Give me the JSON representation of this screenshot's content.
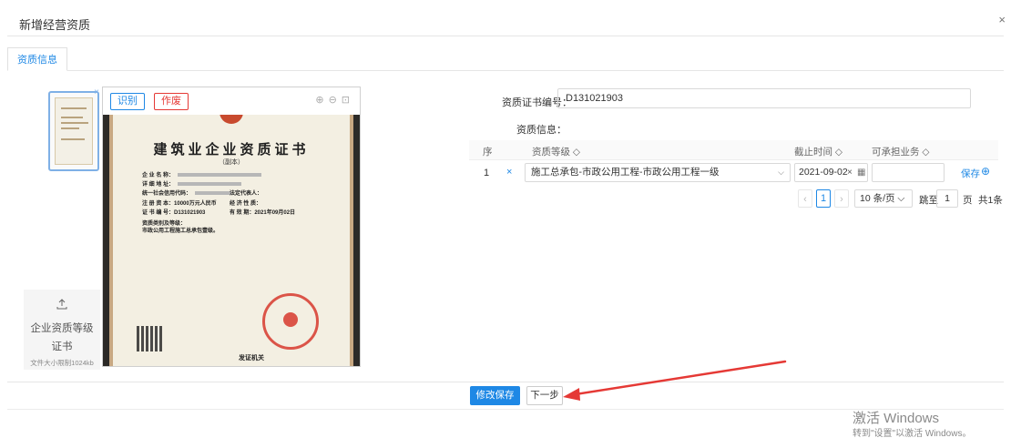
{
  "modal": {
    "title": "新增经营资质",
    "close": "×"
  },
  "tabs": [
    {
      "label": "资质信息"
    }
  ],
  "thumbnail": {
    "close": "×"
  },
  "upload": {
    "icon": "upload-icon",
    "label": "企业资质等级证书",
    "hint": "文件大小限制1024kb"
  },
  "viewer": {
    "recognize_label": "识别",
    "void_label": "作废",
    "tools": [
      "zoom-in-icon",
      "zoom-out-icon",
      "fit-icon"
    ]
  },
  "certificate": {
    "title": "建筑业企业资质证书",
    "subtitle": "（副本）",
    "fields": [
      {
        "label": "企 业 名 称："
      },
      {
        "label": "详 细 地 址："
      },
      {
        "label": "统一社会信用代码："
      },
      {
        "label": "注 册 资 本：",
        "value": "10000万元人民币"
      },
      {
        "label": "证 书 编 号：",
        "value": "D131021903"
      }
    ],
    "fields_right": [
      {
        "label": "法定代表人："
      },
      {
        "label": "经 济 性 质："
      },
      {
        "label": "有 效 期：",
        "value": "2021年09月02日"
      }
    ],
    "scope_title": "资质类别及等级：",
    "scope_text": "市政公用工程施工总承包壹级。",
    "issuer": "发证机关"
  },
  "form": {
    "cert_no_label": "资质证书编号：",
    "cert_no_value": "D131021903",
    "info_label": "资质信息："
  },
  "table": {
    "headers": {
      "index": "序",
      "level": "资质等级 ◇",
      "deadline": "截止时间 ◇",
      "business": "可承担业务 ◇"
    },
    "rows": [
      {
        "index": "1",
        "delete": "×",
        "level": "施工总承包-市政公用工程-市政公用工程一级",
        "deadline": "2021-09-02",
        "business": "",
        "save": "保存",
        "add": "⊕"
      }
    ]
  },
  "pagination": {
    "prev": "‹",
    "current": "1",
    "next": "›",
    "page_size": "10 条/页",
    "goto_label": "跳至",
    "goto_value": "1",
    "page_unit": "页",
    "total": "共1条"
  },
  "footer": {
    "save_label": "修改保存",
    "next_label": "下一步"
  },
  "annotation": {
    "color": "#e53935"
  },
  "watermark": {
    "title": "激活 Windows",
    "subtitle": "转到\"设置\"以激活 Windows。"
  },
  "colors": {
    "accent": "#1e88e5",
    "danger": "#e53935"
  }
}
